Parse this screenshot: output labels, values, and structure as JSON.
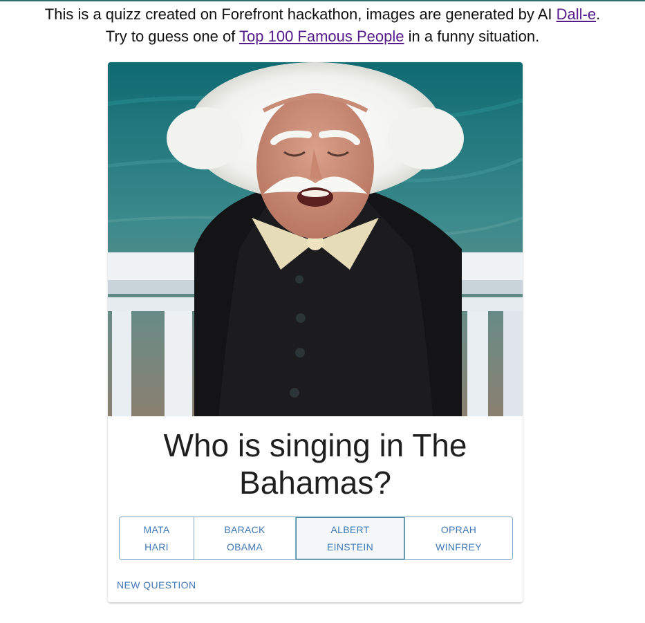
{
  "intro": {
    "line1_text": "This is a quizz created on Forefront hackathon, images are generated by AI ",
    "line1_link": "Dall-e",
    "line1_end": ".",
    "line2_text": "Try to guess one of ",
    "line2_link": "Top 100 Famous People",
    "line2_end": " in a funny situation."
  },
  "card": {
    "image_subject": "AI-generated portrait of a white-haired man with a mustache singing by the sea in a black suit and cream bow tie",
    "question": "Who is singing in The Bahamas?",
    "answers": [
      {
        "line1": "MATA",
        "line2": "HARI",
        "selected": false
      },
      {
        "line1": "BARACK",
        "line2": "OBAMA",
        "selected": false
      },
      {
        "line1": "ALBERT",
        "line2": "EINSTEIN",
        "selected": true
      },
      {
        "line1": "OPRAH",
        "line2": "WINFREY",
        "selected": false
      }
    ],
    "new_question_label": "NEW QUESTION"
  },
  "colors": {
    "accent": "#3f78b7",
    "link_visited": "#551a8b",
    "answer_border": "#7fa8c4",
    "selected_border": "#4a8aa0"
  }
}
